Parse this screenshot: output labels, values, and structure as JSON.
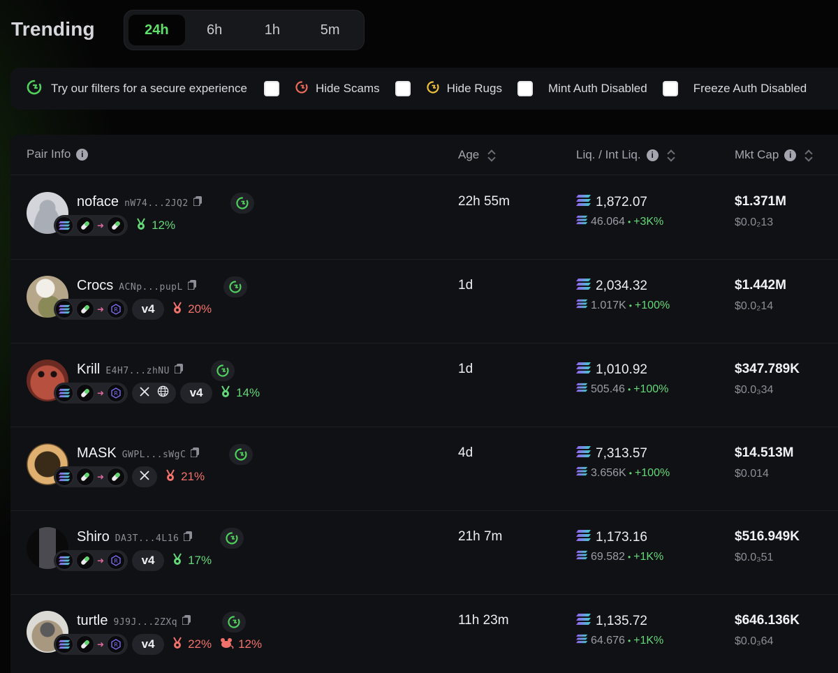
{
  "header": {
    "title": "Trending",
    "tabs": [
      {
        "label": "24h",
        "active": true
      },
      {
        "label": "6h",
        "active": false
      },
      {
        "label": "1h",
        "active": false
      },
      {
        "label": "5m",
        "active": false
      }
    ]
  },
  "filters": {
    "hint": "Try our filters for a secure experience",
    "items": [
      {
        "label": "Hide Scams",
        "checked": false,
        "icon": "red-shield-icon"
      },
      {
        "label": "Hide Rugs",
        "checked": false,
        "icon": "yellow-shield-icon"
      },
      {
        "label": "Mint Auth Disabled",
        "checked": false
      },
      {
        "label": "Freeze Auth Disabled",
        "checked": false
      }
    ]
  },
  "table": {
    "columns": {
      "pair_info": "Pair Info",
      "age": "Age",
      "liquidity": "Liq. / Int Liq.",
      "mkt_cap": "Mkt Cap"
    },
    "rows": [
      {
        "name": "noface",
        "address": "nW74...2JQ2",
        "age": "22h 55m",
        "liq": "1,872.07",
        "int_liq": "46.064",
        "liq_change": "+3K%",
        "mkt_cap": "$1.371M",
        "price": "$0.0₂13",
        "holder_pct": "12%",
        "holder_status": "good",
        "tag": null,
        "second_pct": null,
        "dex": "pill",
        "socials": []
      },
      {
        "name": "Crocs",
        "address": "ACNp...pupL",
        "age": "1d",
        "liq": "2,034.32",
        "int_liq": "1.017K",
        "liq_change": "+100%",
        "mkt_cap": "$1.442M",
        "price": "$0.0₂14",
        "holder_pct": "20%",
        "holder_status": "bad",
        "tag": "v4",
        "second_pct": null,
        "dex": "raydium",
        "socials": []
      },
      {
        "name": "Krill",
        "address": "E4H7...zhNU",
        "age": "1d",
        "liq": "1,010.92",
        "int_liq": "505.46",
        "liq_change": "+100%",
        "mkt_cap": "$347.789K",
        "price": "$0.0₃34",
        "holder_pct": "14%",
        "holder_status": "good",
        "tag": "v4",
        "second_pct": null,
        "dex": "raydium",
        "socials": [
          "x-icon",
          "globe-icon"
        ]
      },
      {
        "name": "MASK",
        "address": "GWPL...sWgC",
        "age": "4d",
        "liq": "7,313.57",
        "int_liq": "3.656K",
        "liq_change": "+100%",
        "mkt_cap": "$14.513M",
        "price": "$0.014",
        "holder_pct": "21%",
        "holder_status": "bad",
        "tag": null,
        "second_pct": null,
        "dex": "pill",
        "socials": [
          "x-icon"
        ]
      },
      {
        "name": "Shiro",
        "address": "DA3T...4L16",
        "age": "21h 7m",
        "liq": "1,173.16",
        "int_liq": "69.582",
        "liq_change": "+1K%",
        "mkt_cap": "$516.949K",
        "price": "$0.0₃51",
        "holder_pct": "17%",
        "holder_status": "good",
        "tag": "v4",
        "second_pct": null,
        "dex": "raydium",
        "socials": []
      },
      {
        "name": "turtle",
        "address": "9J9J...2ZXq",
        "age": "11h 23m",
        "liq": "1,135.72",
        "int_liq": "64.676",
        "liq_change": "+1K%",
        "mkt_cap": "$646.136K",
        "price": "$0.0₃64",
        "holder_pct": "22%",
        "holder_status": "bad",
        "tag": "v4",
        "second_pct": "12%",
        "dex": "raydium",
        "socials": []
      }
    ]
  },
  "colors": {
    "accent_green": "#5fe06a",
    "positive": "#63d879",
    "negative": "#f2726b",
    "background": "#050506",
    "panel": "#101115"
  }
}
